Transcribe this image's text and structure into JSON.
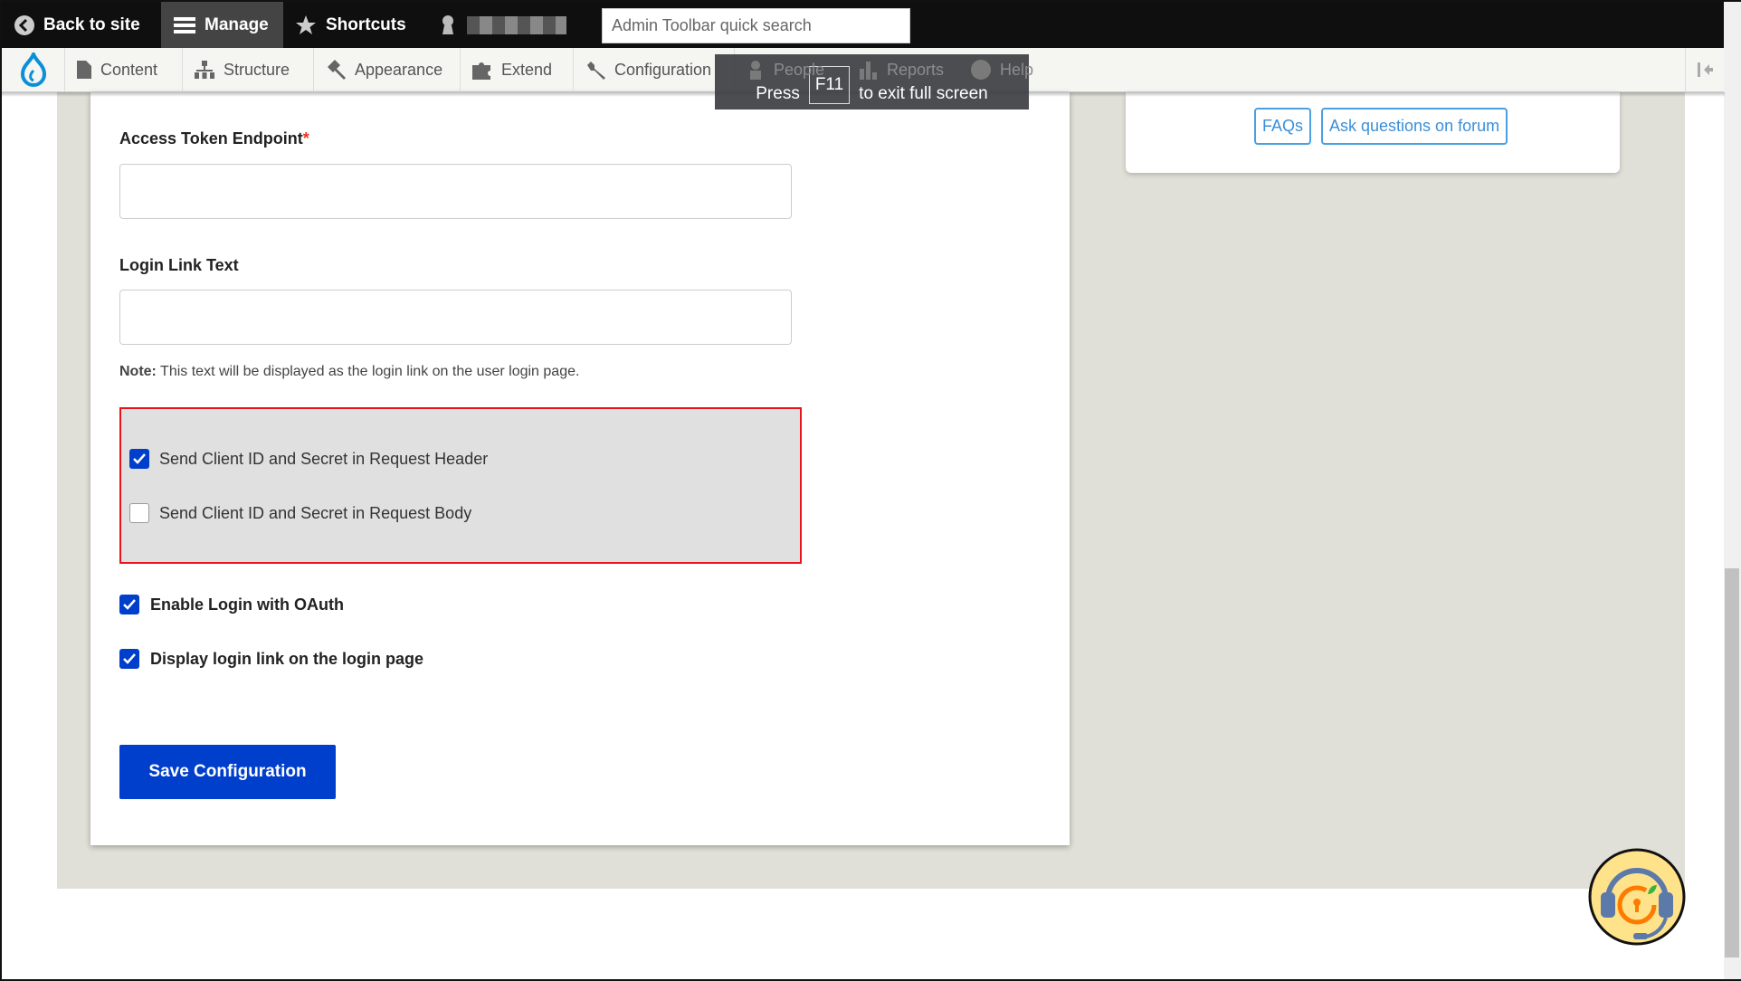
{
  "toolbar": {
    "back": "Back to site",
    "manage": "Manage",
    "shortcuts": "Shortcuts",
    "search_placeholder": "Admin Toolbar quick search"
  },
  "nav": {
    "items": [
      "Content",
      "Structure",
      "Appearance",
      "Extend",
      "Configuration",
      "People",
      "Reports",
      "Help"
    ]
  },
  "fullscreen": {
    "press": "Press",
    "key": "F11",
    "rest": "to exit full screen"
  },
  "side": {
    "faqs": "FAQs",
    "forum": "Ask questions on forum"
  },
  "form": {
    "access_token_label": "Access Token Endpoint",
    "required_mark": "*",
    "access_token_value": "",
    "login_link_label": "Login Link Text",
    "login_link_value": "",
    "note_bold": "Note:",
    "note_text": " This text will be displayed as the login link on the user login page.",
    "options": [
      {
        "label": "Send Client ID and Secret in Request Header",
        "checked": true
      },
      {
        "label": "Send Client ID and Secret in Request Body",
        "checked": false
      }
    ],
    "enable_login": {
      "label": "Enable Login with OAuth",
      "checked": true
    },
    "display_link": {
      "label": "Display login link on the login page",
      "checked": true
    },
    "save": "Save Configuration"
  },
  "colors": {
    "accent": "#003ecc",
    "highlight_border": "#e8141c",
    "link": "#3a8fd8"
  }
}
